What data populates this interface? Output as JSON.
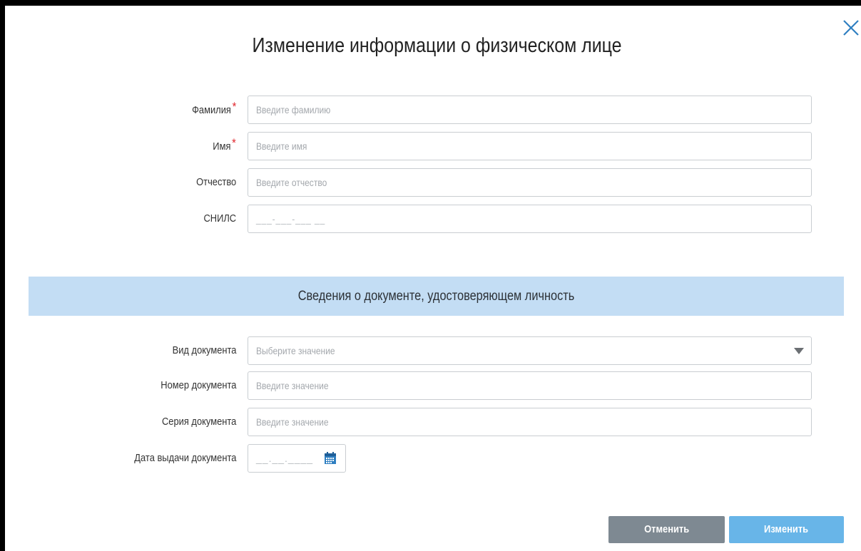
{
  "dialog": {
    "title": "Изменение информации о физическом лице"
  },
  "person": {
    "surname": {
      "label": "Фамилия",
      "required": "*",
      "placeholder": "Введите фамилию"
    },
    "name": {
      "label": "Имя",
      "required": "*",
      "placeholder": "Введите имя"
    },
    "patronymic": {
      "label": "Отчество",
      "placeholder": "Введите отчество"
    },
    "snils": {
      "label": "СНИЛС",
      "mask": "___-___-___ __"
    }
  },
  "document_section": {
    "title": "Сведения о документе, удостоверяющем личность",
    "doc_type": {
      "label": "Вид документа",
      "placeholder": "Выберите значение"
    },
    "doc_number": {
      "label": "Номер документа",
      "placeholder": "Введите значение"
    },
    "doc_series": {
      "label": "Серия документа",
      "placeholder": "Введите значение"
    },
    "doc_date": {
      "label": "Дата выдачи документа",
      "mask": "__.__.____"
    }
  },
  "actions": {
    "cancel": "Отменить",
    "submit": "Изменить"
  },
  "colors": {
    "section_bg": "#c3ddf4",
    "cancel_bg": "#7e8992",
    "submit_bg": "#68b5e8",
    "required": "#e0262d",
    "close_icon": "#2f7fc1",
    "calendar_icon": "#2f7fc1"
  },
  "icons": {
    "close": "close-icon",
    "dropdown": "chevron-down-icon",
    "calendar": "calendar-icon"
  }
}
